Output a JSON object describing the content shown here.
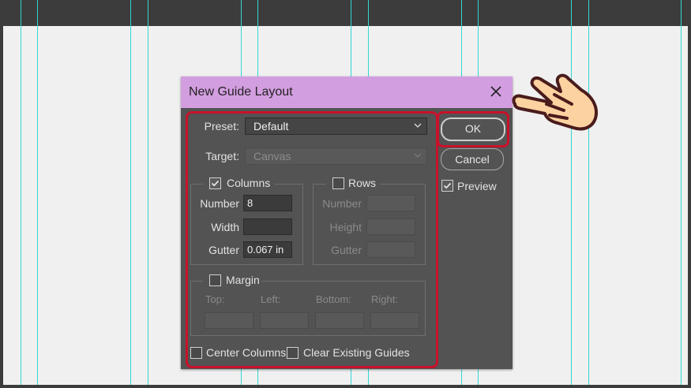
{
  "dialog": {
    "title": "New Guide Layout",
    "preset_label": "Preset:",
    "preset_value": "Default",
    "target_label": "Target:",
    "target_value": "Canvas",
    "ok_label": "OK",
    "cancel_label": "Cancel",
    "preview_label": "Preview",
    "preview_checked": true
  },
  "columns": {
    "label": "Columns",
    "checked": true,
    "number_label": "Number",
    "number_value": "8",
    "width_label": "Width",
    "width_value": "",
    "gutter_label": "Gutter",
    "gutter_value": "0.067 in"
  },
  "rows": {
    "label": "Rows",
    "checked": false,
    "number_label": "Number",
    "height_label": "Height",
    "gutter_label": "Gutter"
  },
  "margin": {
    "label": "Margin",
    "checked": false,
    "top_label": "Top:",
    "left_label": "Left:",
    "bottom_label": "Bottom:",
    "right_label": "Right:"
  },
  "options": {
    "center_columns_label": "Center Columns",
    "center_columns_checked": false,
    "clear_guides_label": "Clear Existing Guides",
    "clear_guides_checked": false
  },
  "colors": {
    "titlebar": "#d39ee0",
    "guide": "#33d6d6",
    "highlight": "#c8112b",
    "dialog_bg": "#535353"
  },
  "icons": {
    "close": "close-icon",
    "chevron": "chevron-down-icon",
    "pointer": "pointing-hand-icon"
  }
}
